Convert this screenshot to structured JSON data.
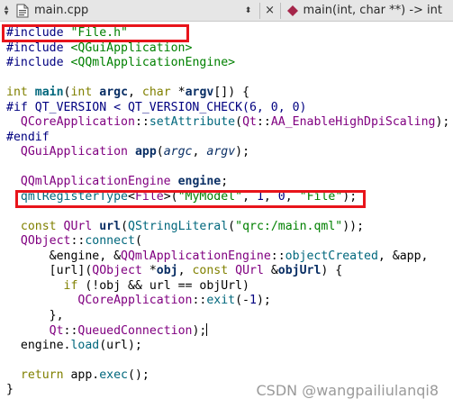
{
  "tab": {
    "filename": "main.cpp",
    "combo_glyph": "◆",
    "close_glyph": "×",
    "symbol": "main(int, char **) -> int",
    "colors": {
      "bar": "#e6e6e6",
      "symbol_icon": "#a5264a"
    }
  },
  "code": {
    "lines": [
      [
        {
          "t": "#include ",
          "c": "pp"
        },
        {
          "t": "\"File.h\"",
          "c": "str"
        }
      ],
      [
        {
          "t": "#include ",
          "c": "pp"
        },
        {
          "t": "<QGuiApplication>",
          "c": "str"
        }
      ],
      [
        {
          "t": "#include ",
          "c": "pp"
        },
        {
          "t": "<QQmlApplicationEngine>",
          "c": "str"
        }
      ],
      [],
      [
        {
          "t": "int ",
          "c": "kw"
        },
        {
          "t": "main",
          "c": "fnb"
        },
        {
          "t": "(",
          "c": "plain"
        },
        {
          "t": "int ",
          "c": "kw"
        },
        {
          "t": "argc",
          "c": "lvar"
        },
        {
          "t": ", ",
          "c": "plain"
        },
        {
          "t": "char ",
          "c": "kw"
        },
        {
          "t": "*",
          "c": "plain"
        },
        {
          "t": "argv",
          "c": "lvar"
        },
        {
          "t": "[]) {",
          "c": "plain"
        }
      ],
      [
        {
          "t": "#if QT_VERSION < QT_VERSION_CHECK(6, 0, 0)",
          "c": "pp"
        }
      ],
      [
        {
          "t": "  ",
          "c": "plain"
        },
        {
          "t": "QCoreApplication",
          "c": "typ"
        },
        {
          "t": "::",
          "c": "plain"
        },
        {
          "t": "setAttribute",
          "c": "fn"
        },
        {
          "t": "(",
          "c": "plain"
        },
        {
          "t": "Qt",
          "c": "typ"
        },
        {
          "t": "::",
          "c": "plain"
        },
        {
          "t": "AA_EnableHighDpiScaling",
          "c": "typ"
        },
        {
          "t": ");",
          "c": "plain"
        }
      ],
      [
        {
          "t": "#endif",
          "c": "pp"
        }
      ],
      [
        {
          "t": "  ",
          "c": "plain"
        },
        {
          "t": "QGuiApplication ",
          "c": "typ"
        },
        {
          "t": "app",
          "c": "lvar"
        },
        {
          "t": "(",
          "c": "plain"
        },
        {
          "t": "argc",
          "c": "arg"
        },
        {
          "t": ", ",
          "c": "plain"
        },
        {
          "t": "argv",
          "c": "arg"
        },
        {
          "t": ");",
          "c": "plain"
        }
      ],
      [],
      [
        {
          "t": "  ",
          "c": "plain"
        },
        {
          "t": "QQmlApplicationEngine ",
          "c": "typ"
        },
        {
          "t": "engine",
          "c": "lvar"
        },
        {
          "t": ";",
          "c": "plain"
        }
      ],
      [
        {
          "t": "  ",
          "c": "plain"
        },
        {
          "t": "qmlRegisterType",
          "c": "fn"
        },
        {
          "t": "<",
          "c": "plain"
        },
        {
          "t": "File",
          "c": "typ"
        },
        {
          "t": ">(",
          "c": "plain"
        },
        {
          "t": "\"MyModel\"",
          "c": "str"
        },
        {
          "t": ", ",
          "c": "plain"
        },
        {
          "t": "1",
          "c": "num"
        },
        {
          "t": ", ",
          "c": "plain"
        },
        {
          "t": "0",
          "c": "num"
        },
        {
          "t": ", ",
          "c": "plain"
        },
        {
          "t": "\"File\"",
          "c": "str"
        },
        {
          "t": ");",
          "c": "plain"
        }
      ],
      [],
      [
        {
          "t": "  ",
          "c": "plain"
        },
        {
          "t": "const ",
          "c": "kw"
        },
        {
          "t": "QUrl ",
          "c": "typ"
        },
        {
          "t": "url",
          "c": "lvar"
        },
        {
          "t": "(",
          "c": "plain"
        },
        {
          "t": "QStringLiteral",
          "c": "fn"
        },
        {
          "t": "(",
          "c": "plain"
        },
        {
          "t": "\"qrc:/main.qml\"",
          "c": "str"
        },
        {
          "t": "));",
          "c": "plain"
        }
      ],
      [
        {
          "t": "  ",
          "c": "plain"
        },
        {
          "t": "QObject",
          "c": "typ"
        },
        {
          "t": "::",
          "c": "plain"
        },
        {
          "t": "connect",
          "c": "fn"
        },
        {
          "t": "(",
          "c": "plain"
        }
      ],
      [
        {
          "t": "      &engine, &",
          "c": "plain"
        },
        {
          "t": "QQmlApplicationEngine",
          "c": "typ"
        },
        {
          "t": "::",
          "c": "plain"
        },
        {
          "t": "objectCreated",
          "c": "fn"
        },
        {
          "t": ", &app,",
          "c": "plain"
        }
      ],
      [
        {
          "t": "      [url](",
          "c": "plain"
        },
        {
          "t": "QObject ",
          "c": "typ"
        },
        {
          "t": "*",
          "c": "plain"
        },
        {
          "t": "obj",
          "c": "lvar"
        },
        {
          "t": ", ",
          "c": "plain"
        },
        {
          "t": "const ",
          "c": "kw"
        },
        {
          "t": "QUrl ",
          "c": "typ"
        },
        {
          "t": "&",
          "c": "plain"
        },
        {
          "t": "objUrl",
          "c": "lvar"
        },
        {
          "t": ") {",
          "c": "plain"
        }
      ],
      [
        {
          "t": "        ",
          "c": "plain"
        },
        {
          "t": "if ",
          "c": "kw"
        },
        {
          "t": "(!obj && url == objUrl)",
          "c": "plain"
        }
      ],
      [
        {
          "t": "          ",
          "c": "plain"
        },
        {
          "t": "QCoreApplication",
          "c": "typ"
        },
        {
          "t": "::",
          "c": "plain"
        },
        {
          "t": "exit",
          "c": "fn"
        },
        {
          "t": "(-",
          "c": "plain"
        },
        {
          "t": "1",
          "c": "num"
        },
        {
          "t": ");",
          "c": "plain"
        }
      ],
      [
        {
          "t": "      },",
          "c": "plain"
        }
      ],
      [
        {
          "t": "      ",
          "c": "plain"
        },
        {
          "t": "Qt",
          "c": "typ"
        },
        {
          "t": "::",
          "c": "plain"
        },
        {
          "t": "QueuedConnection",
          "c": "typ"
        },
        {
          "t": ");",
          "c": "plain"
        },
        {
          "caret": true
        }
      ],
      [
        {
          "t": "  engine.",
          "c": "plain"
        },
        {
          "t": "load",
          "c": "fn"
        },
        {
          "t": "(url);",
          "c": "plain"
        }
      ],
      [],
      [
        {
          "t": "  ",
          "c": "plain"
        },
        {
          "t": "return ",
          "c": "kw"
        },
        {
          "t": "app.",
          "c": "plain"
        },
        {
          "t": "exec",
          "c": "fn"
        },
        {
          "t": "();",
          "c": "plain"
        }
      ],
      [
        {
          "t": "}",
          "c": "plain"
        }
      ]
    ]
  },
  "highlights": [
    {
      "label": "include-file-h",
      "color": "#e8141b"
    },
    {
      "label": "qml-register-type",
      "color": "#e8141b"
    }
  ],
  "watermark": "CSDN @wangpailiulanqi8"
}
